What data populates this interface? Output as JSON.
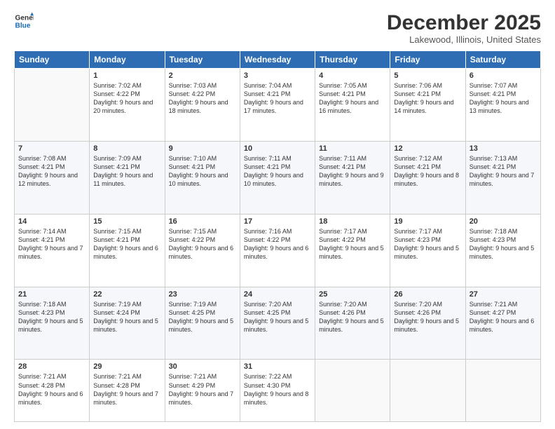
{
  "logo": {
    "line1": "General",
    "line2": "Blue"
  },
  "title": "December 2025",
  "location": "Lakewood, Illinois, United States",
  "days_of_week": [
    "Sunday",
    "Monday",
    "Tuesday",
    "Wednesday",
    "Thursday",
    "Friday",
    "Saturday"
  ],
  "weeks": [
    [
      {
        "num": "",
        "sunrise": "",
        "sunset": "",
        "daylight": ""
      },
      {
        "num": "1",
        "sunrise": "Sunrise: 7:02 AM",
        "sunset": "Sunset: 4:22 PM",
        "daylight": "Daylight: 9 hours and 20 minutes."
      },
      {
        "num": "2",
        "sunrise": "Sunrise: 7:03 AM",
        "sunset": "Sunset: 4:22 PM",
        "daylight": "Daylight: 9 hours and 18 minutes."
      },
      {
        "num": "3",
        "sunrise": "Sunrise: 7:04 AM",
        "sunset": "Sunset: 4:21 PM",
        "daylight": "Daylight: 9 hours and 17 minutes."
      },
      {
        "num": "4",
        "sunrise": "Sunrise: 7:05 AM",
        "sunset": "Sunset: 4:21 PM",
        "daylight": "Daylight: 9 hours and 16 minutes."
      },
      {
        "num": "5",
        "sunrise": "Sunrise: 7:06 AM",
        "sunset": "Sunset: 4:21 PM",
        "daylight": "Daylight: 9 hours and 14 minutes."
      },
      {
        "num": "6",
        "sunrise": "Sunrise: 7:07 AM",
        "sunset": "Sunset: 4:21 PM",
        "daylight": "Daylight: 9 hours and 13 minutes."
      }
    ],
    [
      {
        "num": "7",
        "sunrise": "Sunrise: 7:08 AM",
        "sunset": "Sunset: 4:21 PM",
        "daylight": "Daylight: 9 hours and 12 minutes."
      },
      {
        "num": "8",
        "sunrise": "Sunrise: 7:09 AM",
        "sunset": "Sunset: 4:21 PM",
        "daylight": "Daylight: 9 hours and 11 minutes."
      },
      {
        "num": "9",
        "sunrise": "Sunrise: 7:10 AM",
        "sunset": "Sunset: 4:21 PM",
        "daylight": "Daylight: 9 hours and 10 minutes."
      },
      {
        "num": "10",
        "sunrise": "Sunrise: 7:11 AM",
        "sunset": "Sunset: 4:21 PM",
        "daylight": "Daylight: 9 hours and 10 minutes."
      },
      {
        "num": "11",
        "sunrise": "Sunrise: 7:11 AM",
        "sunset": "Sunset: 4:21 PM",
        "daylight": "Daylight: 9 hours and 9 minutes."
      },
      {
        "num": "12",
        "sunrise": "Sunrise: 7:12 AM",
        "sunset": "Sunset: 4:21 PM",
        "daylight": "Daylight: 9 hours and 8 minutes."
      },
      {
        "num": "13",
        "sunrise": "Sunrise: 7:13 AM",
        "sunset": "Sunset: 4:21 PM",
        "daylight": "Daylight: 9 hours and 7 minutes."
      }
    ],
    [
      {
        "num": "14",
        "sunrise": "Sunrise: 7:14 AM",
        "sunset": "Sunset: 4:21 PM",
        "daylight": "Daylight: 9 hours and 7 minutes."
      },
      {
        "num": "15",
        "sunrise": "Sunrise: 7:15 AM",
        "sunset": "Sunset: 4:21 PM",
        "daylight": "Daylight: 9 hours and 6 minutes."
      },
      {
        "num": "16",
        "sunrise": "Sunrise: 7:15 AM",
        "sunset": "Sunset: 4:22 PM",
        "daylight": "Daylight: 9 hours and 6 minutes."
      },
      {
        "num": "17",
        "sunrise": "Sunrise: 7:16 AM",
        "sunset": "Sunset: 4:22 PM",
        "daylight": "Daylight: 9 hours and 6 minutes."
      },
      {
        "num": "18",
        "sunrise": "Sunrise: 7:17 AM",
        "sunset": "Sunset: 4:22 PM",
        "daylight": "Daylight: 9 hours and 5 minutes."
      },
      {
        "num": "19",
        "sunrise": "Sunrise: 7:17 AM",
        "sunset": "Sunset: 4:23 PM",
        "daylight": "Daylight: 9 hours and 5 minutes."
      },
      {
        "num": "20",
        "sunrise": "Sunrise: 7:18 AM",
        "sunset": "Sunset: 4:23 PM",
        "daylight": "Daylight: 9 hours and 5 minutes."
      }
    ],
    [
      {
        "num": "21",
        "sunrise": "Sunrise: 7:18 AM",
        "sunset": "Sunset: 4:23 PM",
        "daylight": "Daylight: 9 hours and 5 minutes."
      },
      {
        "num": "22",
        "sunrise": "Sunrise: 7:19 AM",
        "sunset": "Sunset: 4:24 PM",
        "daylight": "Daylight: 9 hours and 5 minutes."
      },
      {
        "num": "23",
        "sunrise": "Sunrise: 7:19 AM",
        "sunset": "Sunset: 4:25 PM",
        "daylight": "Daylight: 9 hours and 5 minutes."
      },
      {
        "num": "24",
        "sunrise": "Sunrise: 7:20 AM",
        "sunset": "Sunset: 4:25 PM",
        "daylight": "Daylight: 9 hours and 5 minutes."
      },
      {
        "num": "25",
        "sunrise": "Sunrise: 7:20 AM",
        "sunset": "Sunset: 4:26 PM",
        "daylight": "Daylight: 9 hours and 5 minutes."
      },
      {
        "num": "26",
        "sunrise": "Sunrise: 7:20 AM",
        "sunset": "Sunset: 4:26 PM",
        "daylight": "Daylight: 9 hours and 5 minutes."
      },
      {
        "num": "27",
        "sunrise": "Sunrise: 7:21 AM",
        "sunset": "Sunset: 4:27 PM",
        "daylight": "Daylight: 9 hours and 6 minutes."
      }
    ],
    [
      {
        "num": "28",
        "sunrise": "Sunrise: 7:21 AM",
        "sunset": "Sunset: 4:28 PM",
        "daylight": "Daylight: 9 hours and 6 minutes."
      },
      {
        "num": "29",
        "sunrise": "Sunrise: 7:21 AM",
        "sunset": "Sunset: 4:28 PM",
        "daylight": "Daylight: 9 hours and 7 minutes."
      },
      {
        "num": "30",
        "sunrise": "Sunrise: 7:21 AM",
        "sunset": "Sunset: 4:29 PM",
        "daylight": "Daylight: 9 hours and 7 minutes."
      },
      {
        "num": "31",
        "sunrise": "Sunrise: 7:22 AM",
        "sunset": "Sunset: 4:30 PM",
        "daylight": "Daylight: 9 hours and 8 minutes."
      },
      {
        "num": "",
        "sunrise": "",
        "sunset": "",
        "daylight": ""
      },
      {
        "num": "",
        "sunrise": "",
        "sunset": "",
        "daylight": ""
      },
      {
        "num": "",
        "sunrise": "",
        "sunset": "",
        "daylight": ""
      }
    ]
  ]
}
